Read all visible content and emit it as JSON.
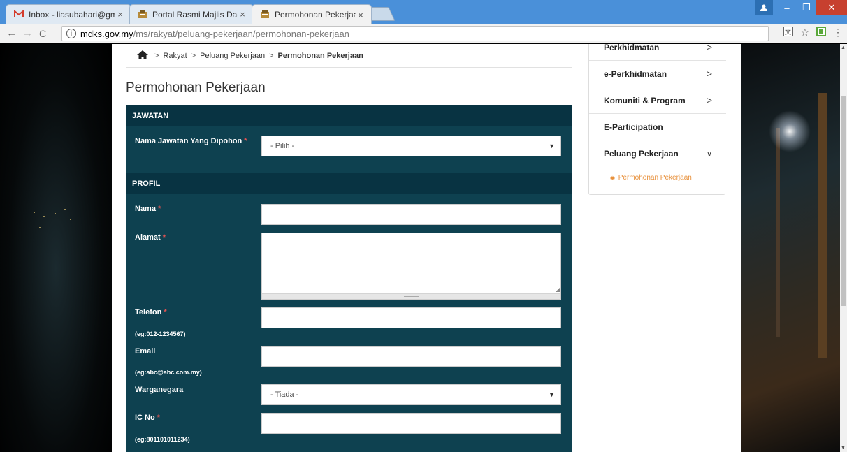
{
  "browser": {
    "tabs": [
      {
        "title": "Inbox - liasubahari@gm",
        "icon": "gmail-icon"
      },
      {
        "title": "Portal Rasmi Majlis Daer",
        "icon": "portal-crest-icon"
      },
      {
        "title": "Permohonan Pekerjaan |",
        "icon": "portal-crest-icon"
      }
    ],
    "url_host": "mdks.gov.my",
    "url_path": "/ms/rakyat/peluang-pekerjaan/permohonan-pekerjaan"
  },
  "breadcrumb": {
    "home_icon": "home-icon",
    "items": [
      "Rakyat",
      "Peluang Pekerjaan",
      "Permohonan Pekerjaan"
    ]
  },
  "page_title": "Permohonan Pekerjaan",
  "form": {
    "section_jawatan": "JAWATAN",
    "jawatan_label": "Nama Jawatan Yang Dipohon",
    "jawatan_value": "- Pilih -",
    "section_profil": "PROFIL",
    "nama_label": "Nama",
    "alamat_label": "Alamat",
    "telefon_label": "Telefon",
    "telefon_hint": "(eg:012-1234567)",
    "email_label": "Email",
    "email_hint": "(eg:abc@abc.com.my)",
    "warganegara_label": "Warganegara",
    "warganegara_value": "- Tiada -",
    "icno_label": "IC No",
    "icno_hint": "(eg:801101011234)",
    "required_mark": "*"
  },
  "sidebar": {
    "items": [
      {
        "label": "Perkhidmatan",
        "chevron": ">"
      },
      {
        "label": "e-Perkhidmatan",
        "chevron": ">"
      },
      {
        "label": "Komuniti & Program",
        "chevron": ">"
      },
      {
        "label": "E-Participation",
        "chevron": ""
      },
      {
        "label": "Peluang Pekerjaan",
        "chevron": "∨"
      }
    ],
    "sub_item": "Permohonan Pekerjaan"
  },
  "colors": {
    "form_bg": "#0e4150",
    "section_bg": "#083342",
    "accent_orange": "#e8913c",
    "required_red": "#e05252"
  }
}
